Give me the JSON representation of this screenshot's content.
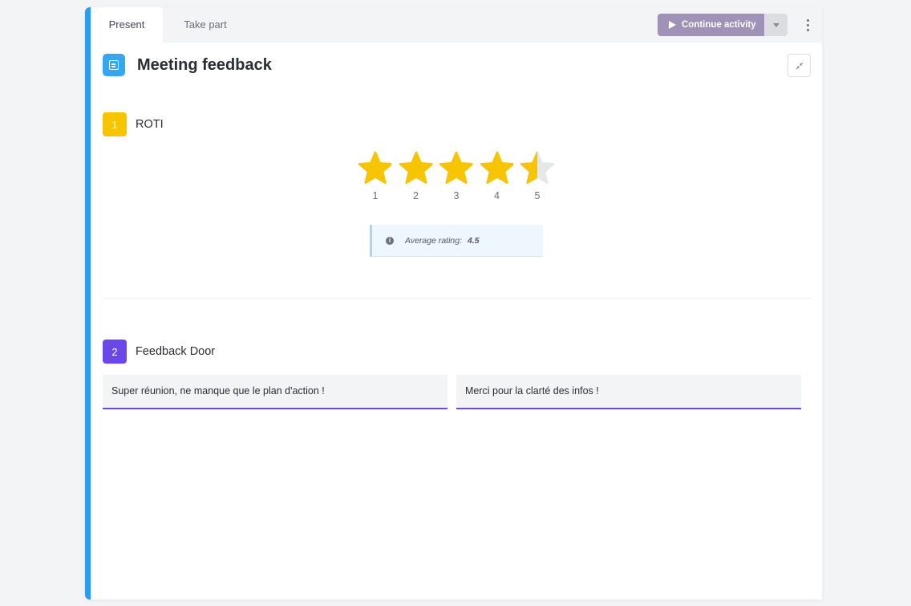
{
  "tabs": {
    "present": "Present",
    "take_part": "Take part"
  },
  "toolbar": {
    "continue_label": "Continue activity"
  },
  "header": {
    "title": "Meeting feedback"
  },
  "questions": [
    {
      "number": "1",
      "title": "ROTI",
      "rating": {
        "max": 5,
        "average": 4.5,
        "labels": [
          "1",
          "2",
          "3",
          "4",
          "5"
        ],
        "average_label": "Average rating:",
        "average_text": "4.5"
      }
    },
    {
      "number": "2",
      "title": "Feedback Door",
      "responses": [
        "Super réunion, ne manque que le plan d'action !",
        "Merci pour la clarté des infos !"
      ]
    }
  ],
  "colors": {
    "accent_blue": "#2d9cf0",
    "star": "#f7c500",
    "question1": "#f7c500",
    "question2": "#6a47e8",
    "continue_button": "#9f92b6"
  }
}
